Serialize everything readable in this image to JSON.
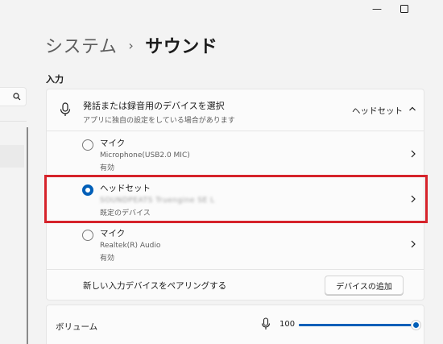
{
  "window_controls": {
    "minimize": "—",
    "maximize": "☐"
  },
  "breadcrumb": {
    "parent": "システム",
    "separator": "›",
    "current": "サウンド"
  },
  "section_title": "入力",
  "input_header": {
    "title": "発話または録音用のデバイスを選択",
    "subtitle": "アプリに独自の設定をしている場合があります",
    "selected_value": "ヘッドセット"
  },
  "devices": [
    {
      "name": "マイク",
      "line1": "Microphone(USB2.0 MIC)",
      "line2": "有効",
      "selected": false
    },
    {
      "name": "ヘッドセット",
      "line1": "SOUNDPEATS Truengine SE L",
      "line2": "既定のデバイス",
      "selected": true
    },
    {
      "name": "マイク",
      "line1": "Realtek(R) Audio",
      "line2": "有効",
      "selected": false
    }
  ],
  "pairing": {
    "label": "新しい入力デバイスをペアリングする",
    "button": "デバイスの追加"
  },
  "volume": {
    "label": "ボリューム",
    "value": 100,
    "value_text": "100"
  },
  "colors": {
    "accent": "#005fb8",
    "highlight": "#d6232b"
  }
}
